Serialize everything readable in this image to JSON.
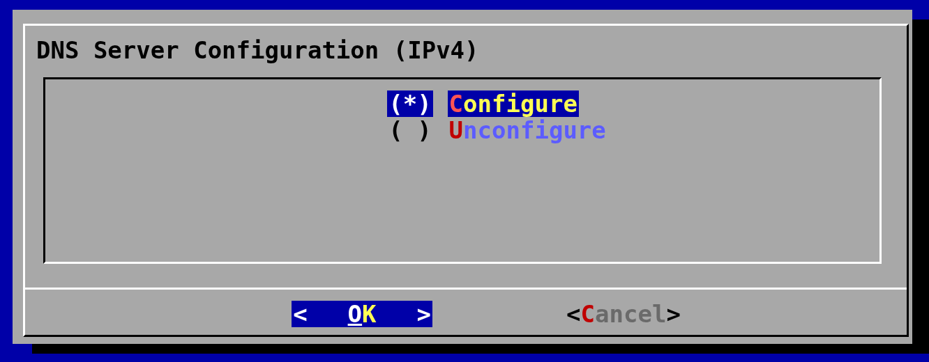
{
  "dialog": {
    "title": "DNS Server Configuration (IPv4)",
    "options": [
      {
        "mark": "(*)",
        "label": "Configure",
        "selected": true
      },
      {
        "mark": "( )",
        "label": "Unconfigure",
        "selected": false
      }
    ],
    "buttons": [
      {
        "open": "<",
        "label": "OK",
        "close": ">",
        "selected": true
      },
      {
        "open": "<",
        "label": "Cancel",
        "close": ">",
        "selected": false
      }
    ]
  }
}
